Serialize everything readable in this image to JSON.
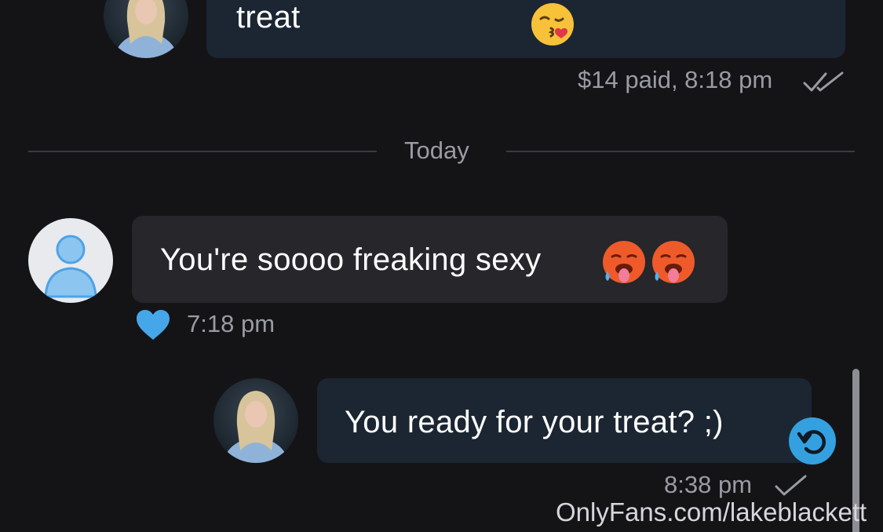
{
  "messages": {
    "top": {
      "text": "treat",
      "emoji": "kiss-face-emoji",
      "meta": "$14 paid, 8:18 pm",
      "status": "double-check-icon"
    },
    "divider": {
      "label": "Today"
    },
    "incoming": {
      "text": "You're soooo freaking sexy",
      "emoji": "hot-face-emoji",
      "time": "7:18 pm",
      "reaction": "heart-icon"
    },
    "outgoing": {
      "text": "You ready for your treat? ;)",
      "time": "8:38 pm",
      "status": "single-check-icon"
    }
  },
  "watermark": "OnlyFans.com/lakeblackett",
  "colors": {
    "background": "#141417",
    "outgoing_bubble": "#1b2632",
    "incoming_bubble": "#26262b",
    "accent": "#34a0e0",
    "heart": "#46a6ea"
  }
}
